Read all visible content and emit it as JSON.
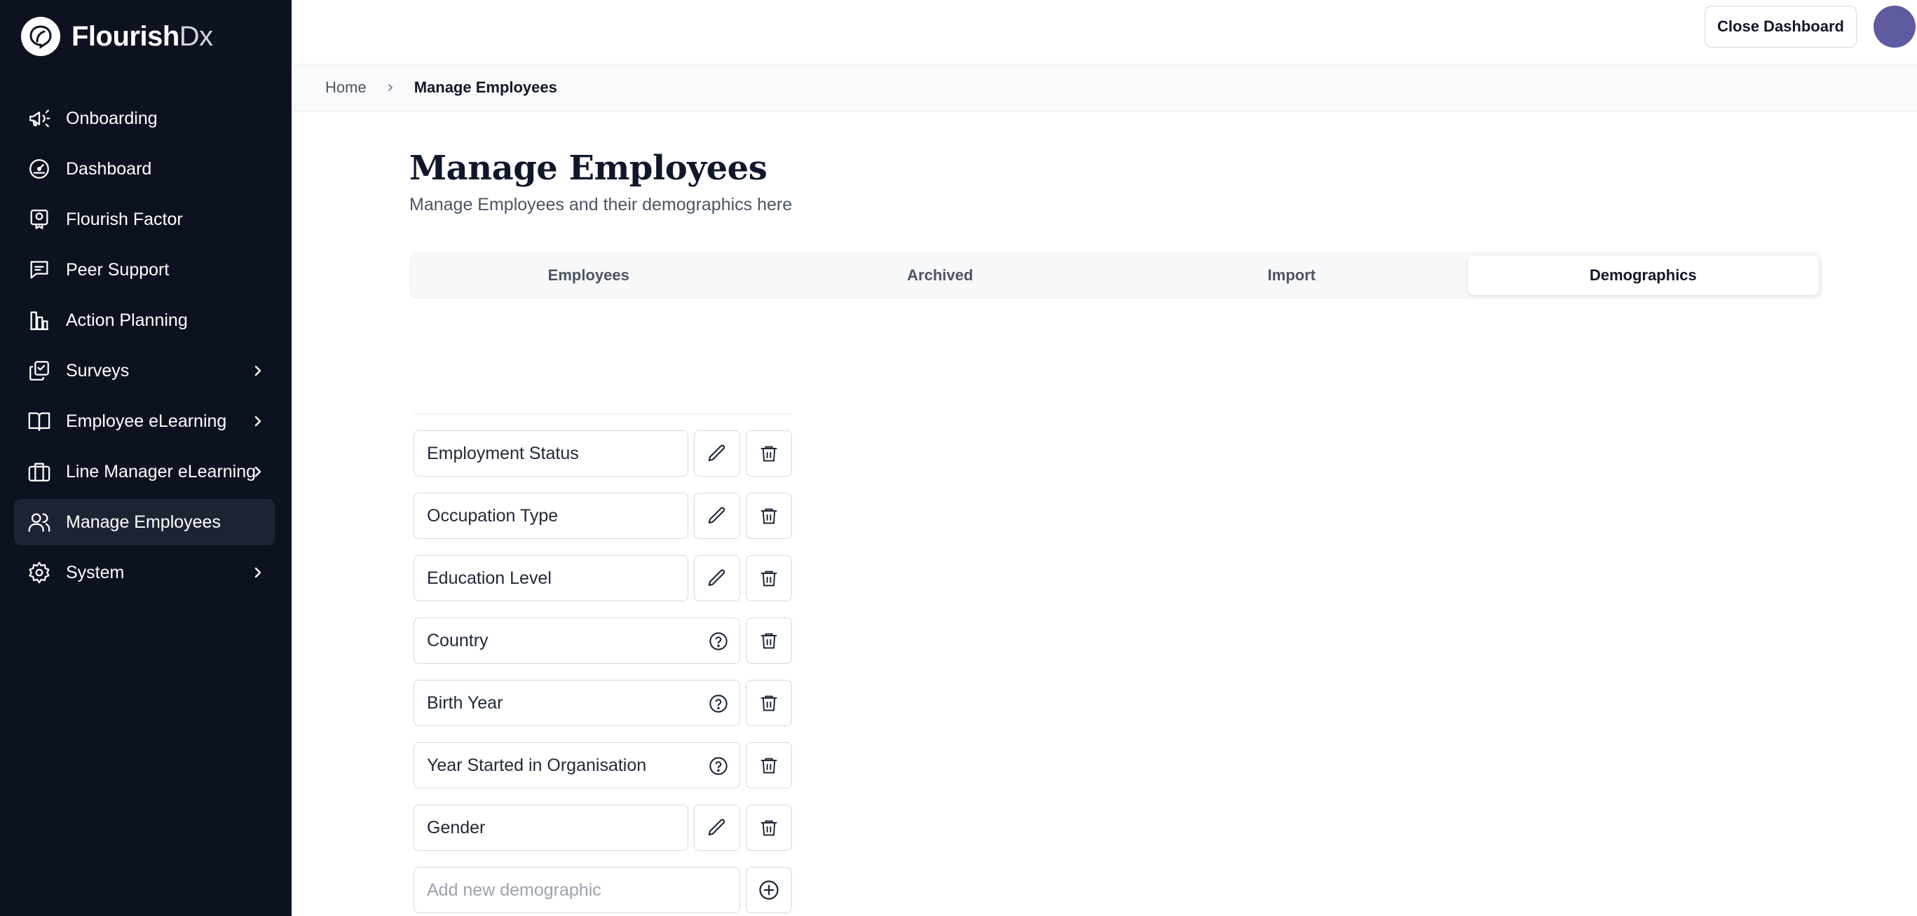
{
  "app": {
    "logo_word": "Flourish",
    "logo_suffix": "Dx"
  },
  "sidebar": {
    "items": [
      {
        "label": "Onboarding",
        "icon": "megaphone-icon"
      },
      {
        "label": "Dashboard",
        "icon": "gauge-icon"
      },
      {
        "label": "Flourish Factor",
        "icon": "certificate-icon"
      },
      {
        "label": "Peer Support",
        "icon": "chat-icon"
      },
      {
        "label": "Action Planning",
        "icon": "bar-chart-icon"
      },
      {
        "label": "Surveys",
        "icon": "survey-icon",
        "expandable": true
      },
      {
        "label": "Employee eLearning",
        "icon": "book-icon",
        "expandable": true
      },
      {
        "label": "Line Manager eLearning",
        "icon": "briefcase-icon",
        "expandable": true
      },
      {
        "label": "Manage Employees",
        "icon": "users-icon",
        "active": true
      },
      {
        "label": "System",
        "icon": "gear-icon",
        "expandable": true
      }
    ]
  },
  "header": {
    "close_label": "Close Dashboard"
  },
  "breadcrumb": {
    "home": "Home",
    "current": "Manage Employees"
  },
  "page": {
    "title": "Manage Employees",
    "subtitle": "Manage Employees and their demographics here"
  },
  "tabs": [
    {
      "label": "Employees"
    },
    {
      "label": "Archived"
    },
    {
      "label": "Import"
    },
    {
      "label": "Demographics",
      "active": true
    }
  ],
  "demographics": [
    {
      "label": "Employment Status",
      "editable": true
    },
    {
      "label": "Occupation Type",
      "editable": true
    },
    {
      "label": "Education Level",
      "editable": true
    },
    {
      "label": "Country",
      "editable": false
    },
    {
      "label": "Birth Year",
      "editable": false
    },
    {
      "label": "Year Started in Organisation",
      "editable": false
    },
    {
      "label": "Gender",
      "editable": true
    }
  ],
  "new_demographic": {
    "placeholder": "Add new demographic"
  },
  "colors": {
    "sidebar_bg": "#0c1220",
    "active_item": "#1c2434",
    "avatar": "#5e5ba0"
  }
}
